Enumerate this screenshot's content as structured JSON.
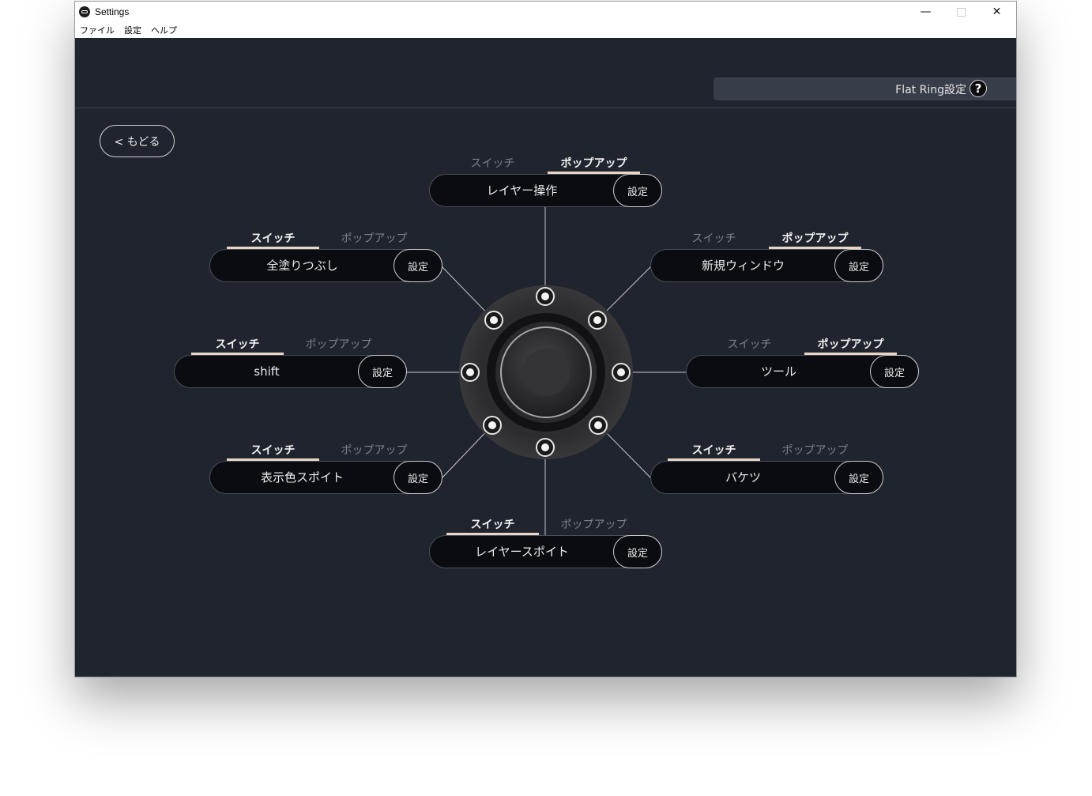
{
  "window": {
    "title": "Settings"
  },
  "menu": [
    "ファイル",
    "設定",
    "ヘルプ"
  ],
  "header": {
    "device_label": "Flat Ring設定",
    "help_glyph": "?"
  },
  "back_label": "< もどる",
  "mode_labels": {
    "switch": "スイッチ",
    "popup": "ポップアップ"
  },
  "set_label": "設定",
  "slots": [
    {
      "id": "top",
      "action": "レイヤー操作",
      "mode": "popup"
    },
    {
      "id": "upper-left",
      "action": "全塗りつぶし",
      "mode": "switch"
    },
    {
      "id": "upper-right",
      "action": "新規ウィンドウ",
      "mode": "popup"
    },
    {
      "id": "left",
      "action": "shift",
      "mode": "switch"
    },
    {
      "id": "right",
      "action": "ツール",
      "mode": "popup"
    },
    {
      "id": "lower-left",
      "action": "表示色スポイト",
      "mode": "switch"
    },
    {
      "id": "lower-right",
      "action": "バケツ",
      "mode": "switch"
    },
    {
      "id": "bottom",
      "action": "レイヤースポイト",
      "mode": "switch"
    }
  ],
  "colors": {
    "background": "#20242e",
    "accent_underline": "#e9d7c6",
    "pill": "#0a0c11"
  }
}
